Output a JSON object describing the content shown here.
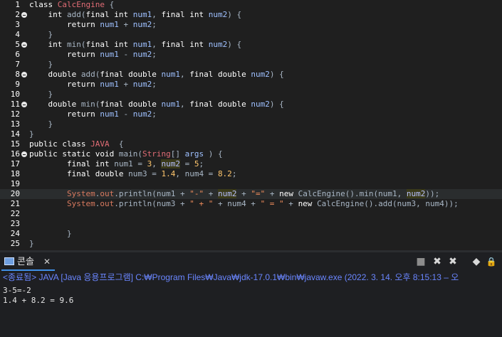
{
  "editor": {
    "lines": [
      {
        "n": "1",
        "fold": false,
        "t": [
          [
            "kw",
            "class "
          ],
          [
            "cls",
            "CalcEngine"
          ],
          [
            "var",
            " {"
          ]
        ]
      },
      {
        "n": "2",
        "fold": true,
        "t": [
          [
            "var",
            "    "
          ],
          [
            "kw",
            "int "
          ],
          [
            "var",
            "add("
          ],
          [
            "kw",
            "final "
          ],
          [
            "kw",
            "int "
          ],
          [
            "par",
            "num1"
          ],
          [
            "var",
            ", "
          ],
          [
            "kw",
            "final "
          ],
          [
            "kw",
            "int "
          ],
          [
            "par",
            "num2"
          ],
          [
            "var",
            ") {"
          ]
        ]
      },
      {
        "n": "3",
        "fold": false,
        "t": [
          [
            "var",
            "        "
          ],
          [
            "kw",
            "return "
          ],
          [
            "par",
            "num1"
          ],
          [
            "var",
            " + "
          ],
          [
            "par",
            "num2"
          ],
          [
            "var",
            ";"
          ]
        ]
      },
      {
        "n": "4",
        "fold": false,
        "t": [
          [
            "var",
            "    }"
          ]
        ]
      },
      {
        "n": "5",
        "fold": true,
        "t": [
          [
            "var",
            "    "
          ],
          [
            "kw",
            "int "
          ],
          [
            "var",
            "min("
          ],
          [
            "kw",
            "final "
          ],
          [
            "kw",
            "int "
          ],
          [
            "par",
            "num1"
          ],
          [
            "var",
            ", "
          ],
          [
            "kw",
            "final "
          ],
          [
            "kw",
            "int "
          ],
          [
            "par",
            "num2"
          ],
          [
            "var",
            ") {"
          ]
        ]
      },
      {
        "n": "6",
        "fold": false,
        "t": [
          [
            "var",
            "        "
          ],
          [
            "kw",
            "return "
          ],
          [
            "par",
            "num1"
          ],
          [
            "var",
            " - "
          ],
          [
            "par",
            "num2"
          ],
          [
            "var",
            ";"
          ]
        ]
      },
      {
        "n": "7",
        "fold": false,
        "t": [
          [
            "var",
            "    }"
          ]
        ]
      },
      {
        "n": "8",
        "fold": true,
        "t": [
          [
            "var",
            "    "
          ],
          [
            "kw",
            "double "
          ],
          [
            "var",
            "add("
          ],
          [
            "kw",
            "final "
          ],
          [
            "kw",
            "double "
          ],
          [
            "par",
            "num1"
          ],
          [
            "var",
            ", "
          ],
          [
            "kw",
            "final "
          ],
          [
            "kw",
            "double "
          ],
          [
            "par",
            "num2"
          ],
          [
            "var",
            ") {"
          ]
        ]
      },
      {
        "n": "9",
        "fold": false,
        "t": [
          [
            "var",
            "        "
          ],
          [
            "kw",
            "return "
          ],
          [
            "par",
            "num1"
          ],
          [
            "var",
            " + "
          ],
          [
            "par",
            "num2"
          ],
          [
            "var",
            ";"
          ]
        ]
      },
      {
        "n": "10",
        "fold": false,
        "t": [
          [
            "var",
            "    }"
          ]
        ]
      },
      {
        "n": "11",
        "fold": true,
        "t": [
          [
            "var",
            "    "
          ],
          [
            "kw",
            "double "
          ],
          [
            "var",
            "min("
          ],
          [
            "kw",
            "final "
          ],
          [
            "kw",
            "double "
          ],
          [
            "par",
            "num1"
          ],
          [
            "var",
            ", "
          ],
          [
            "kw",
            "final "
          ],
          [
            "kw",
            "double "
          ],
          [
            "par",
            "num2"
          ],
          [
            "var",
            ") {"
          ]
        ]
      },
      {
        "n": "12",
        "fold": false,
        "t": [
          [
            "var",
            "        "
          ],
          [
            "kw",
            "return "
          ],
          [
            "par",
            "num1"
          ],
          [
            "var",
            " - "
          ],
          [
            "par",
            "num2"
          ],
          [
            "var",
            ";"
          ]
        ]
      },
      {
        "n": "13",
        "fold": false,
        "t": [
          [
            "var",
            "    }"
          ]
        ]
      },
      {
        "n": "14",
        "fold": false,
        "t": [
          [
            "var",
            "}"
          ]
        ]
      },
      {
        "n": "15",
        "fold": false,
        "t": [
          [
            "kw",
            "public "
          ],
          [
            "kw",
            "class "
          ],
          [
            "cls",
            "JAVA"
          ],
          [
            "var",
            "  {"
          ]
        ]
      },
      {
        "n": "16",
        "fold": true,
        "t": [
          [
            "kw",
            "public "
          ],
          [
            "kw",
            "static "
          ],
          [
            "kw",
            "void "
          ],
          [
            "var",
            "main("
          ],
          [
            "cls",
            "String"
          ],
          [
            "var",
            "[] "
          ],
          [
            "par",
            "args"
          ],
          [
            "var",
            " ) {"
          ]
        ]
      },
      {
        "n": "17",
        "fold": false,
        "t": [
          [
            "var",
            "        "
          ],
          [
            "kw",
            "final "
          ],
          [
            "kw",
            "int "
          ],
          [
            "var",
            "num1 = "
          ],
          [
            "num",
            "3"
          ],
          [
            "var",
            ", "
          ],
          [
            "hl",
            "num2"
          ],
          [
            "var",
            " = "
          ],
          [
            "num",
            "5"
          ],
          [
            "var",
            ";"
          ]
        ]
      },
      {
        "n": "18",
        "fold": false,
        "t": [
          [
            "var",
            "        "
          ],
          [
            "kw",
            "final "
          ],
          [
            "kw",
            "double "
          ],
          [
            "var",
            "num3 = "
          ],
          [
            "num",
            "1.4"
          ],
          [
            "var",
            ", num4 = "
          ],
          [
            "num",
            "8.2"
          ],
          [
            "var",
            ";"
          ]
        ]
      },
      {
        "n": "19",
        "fold": false,
        "t": []
      },
      {
        "n": "20",
        "fold": false,
        "active": true,
        "t": [
          [
            "var",
            "        "
          ],
          [
            "sys",
            "System"
          ],
          [
            "var",
            "."
          ],
          [
            "sys",
            "out"
          ],
          [
            "var",
            ".println("
          ],
          [
            "var",
            "num1 + "
          ],
          [
            "str",
            "\"-\""
          ],
          [
            "var",
            " + "
          ],
          [
            "hl",
            "num2"
          ],
          [
            "var",
            " + "
          ],
          [
            "str",
            "\"=\""
          ],
          [
            "var",
            " + "
          ],
          [
            "kw",
            "new "
          ],
          [
            "var",
            "CalcEngine().min(num1, "
          ],
          [
            "hl",
            "num2"
          ],
          [
            "var",
            "));"
          ]
        ]
      },
      {
        "n": "21",
        "fold": false,
        "t": [
          [
            "var",
            "        "
          ],
          [
            "sys",
            "System"
          ],
          [
            "var",
            "."
          ],
          [
            "sys",
            "out"
          ],
          [
            "var",
            ".println(num3 + "
          ],
          [
            "str",
            "\" + \""
          ],
          [
            "var",
            " + num4 + "
          ],
          [
            "str",
            "\" = \""
          ],
          [
            "var",
            " + "
          ],
          [
            "kw",
            "new "
          ],
          [
            "var",
            "CalcEngine().add(num3, num4));"
          ]
        ]
      },
      {
        "n": "22",
        "fold": false,
        "t": []
      },
      {
        "n": "23",
        "fold": false,
        "t": []
      },
      {
        "n": "24",
        "fold": false,
        "t": [
          [
            "var",
            "        }"
          ]
        ]
      },
      {
        "n": "25",
        "fold": false,
        "t": [
          [
            "var",
            "}"
          ]
        ]
      }
    ]
  },
  "console_tab": {
    "label": "콘솔",
    "close": "✕"
  },
  "toolbar": {
    "terminate": "■",
    "remove": "✖",
    "remove_all": "✖",
    "clear": "◆",
    "lock": "🔒"
  },
  "status": {
    "text": "<종료됨> JAVA [Java 응용프로그램] C:₩Program Files₩Java₩jdk-17.0.1₩bin₩javaw.exe (2022. 3. 14. 오후 8:15:13 – 오"
  },
  "output": [
    "3-5=-2",
    "1.4 + 8.2 = 9.6"
  ]
}
